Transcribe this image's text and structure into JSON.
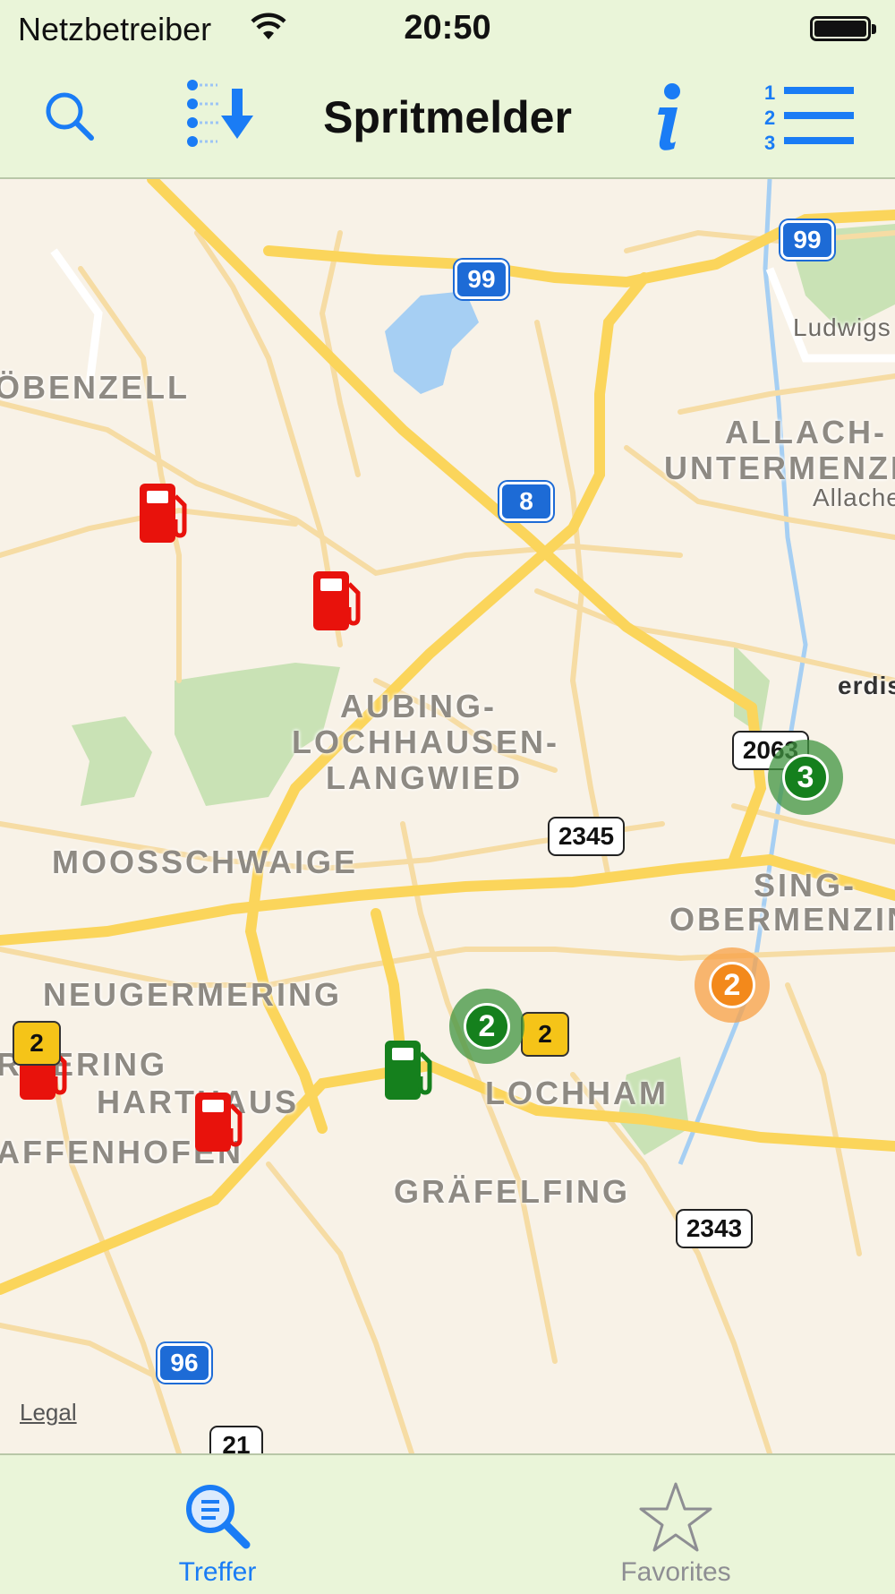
{
  "status_bar": {
    "carrier": "Netzbetreiber",
    "time": "20:50",
    "battery_level": 1.0
  },
  "nav": {
    "title": "Spritmelder",
    "search_icon": "search-icon",
    "sort_icon": "sort-download-icon",
    "info_icon": "info-icon",
    "list_icon": "numbered-list-icon",
    "accent_color": "#1a7cf5"
  },
  "map": {
    "places": {
      "obenzell": "ÖBENZELL",
      "allach": "ALLACH-",
      "untermenzing": "UNTERMENZIN",
      "aubing": "AUBING-",
      "lochhausen": "LOCHHAUSEN-",
      "langwied": "LANGWIED",
      "moosschwaige": "MOOSSCHWAIGE",
      "neugermering": "NEUGERMERING",
      "rmering": "RMERING",
      "harthaus": "HARTHAUS",
      "affenhofen": "AFFENHOFEN",
      "lochham": "LOCHHAM",
      "grafelfing": "GRÄFELFING",
      "pasing": "SING-",
      "obermenzing": "OBERMENZING",
      "ludwigs": "Ludwigs",
      "allache": "Allache",
      "erdist": "erdist"
    },
    "shields": {
      "a99_a": "99",
      "a99_b": "99",
      "a8": "8",
      "a96": "96",
      "r2063": "2063",
      "r2345": "2345",
      "r2343": "2343",
      "r21": "21"
    },
    "clusters": {
      "c3": "3",
      "c2_green": "2",
      "c2_orange": "2"
    },
    "price_tags": {
      "t1": "2",
      "t2": "2"
    },
    "pump_colors": {
      "expensive": "#e8120c",
      "cheap": "#15801d"
    },
    "legal": "Legal"
  },
  "tabs": [
    {
      "label": "Treffer",
      "icon": "search-list-icon",
      "selected": true,
      "color": "#1a7cf5"
    },
    {
      "label": "Favorites",
      "icon": "star-icon",
      "selected": false,
      "color": "#8e8e93"
    }
  ]
}
